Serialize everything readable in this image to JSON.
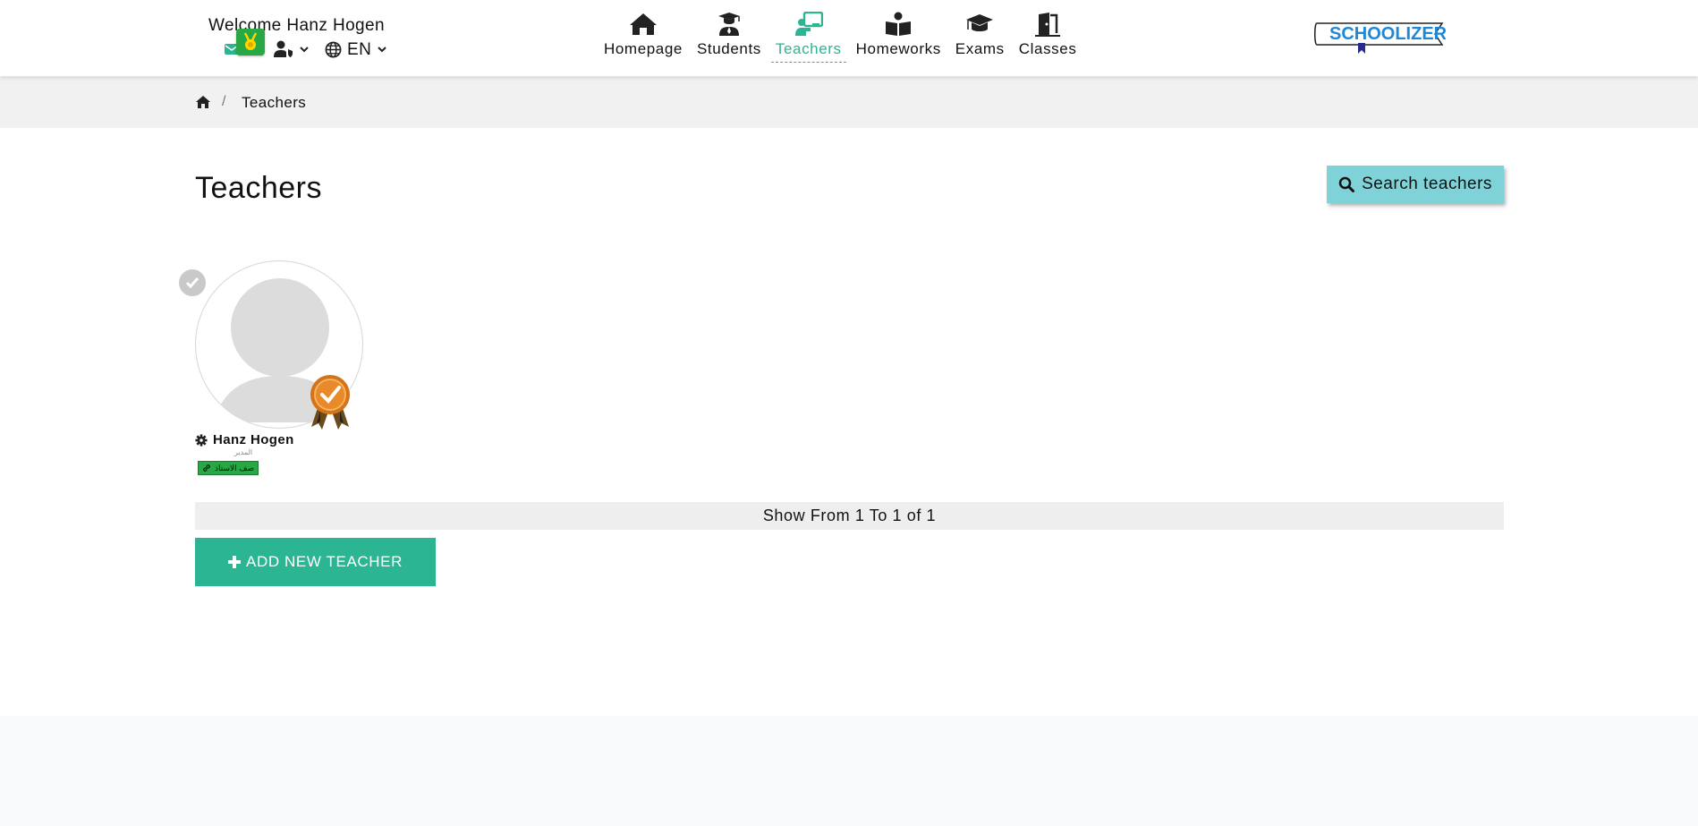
{
  "header": {
    "welcome_text": "Welcome Hanz Hogen",
    "language_label": "EN",
    "logo_text": "SCHOOLIZER",
    "nav": [
      {
        "label": "Homepage",
        "icon": "home-icon"
      },
      {
        "label": "Students",
        "icon": "student-icon"
      },
      {
        "label": "Teachers",
        "icon": "teacher-icon",
        "active": true
      },
      {
        "label": "Homeworks",
        "icon": "book-reader-icon"
      },
      {
        "label": "Exams",
        "icon": "graduation-cap-icon"
      },
      {
        "label": "Classes",
        "icon": "door-open-icon"
      }
    ]
  },
  "breadcrumb": {
    "separator": "/",
    "current": "Teachers"
  },
  "page": {
    "title": "Teachers",
    "search_label": "Search teachers"
  },
  "teachers": [
    {
      "name": "Hanz Hogen",
      "role": "المدير",
      "tag": "صف الاستاذ"
    }
  ],
  "pagination": {
    "info": "Show From 1 To 1 of 1"
  },
  "actions": {
    "add_label": "ADD NEW TEACHER"
  },
  "colors": {
    "accent": "#2cb592",
    "search_button": "#7fd3d8",
    "badge_green": "#28a745",
    "breadcrumb_bg": "#f1f1f1"
  }
}
